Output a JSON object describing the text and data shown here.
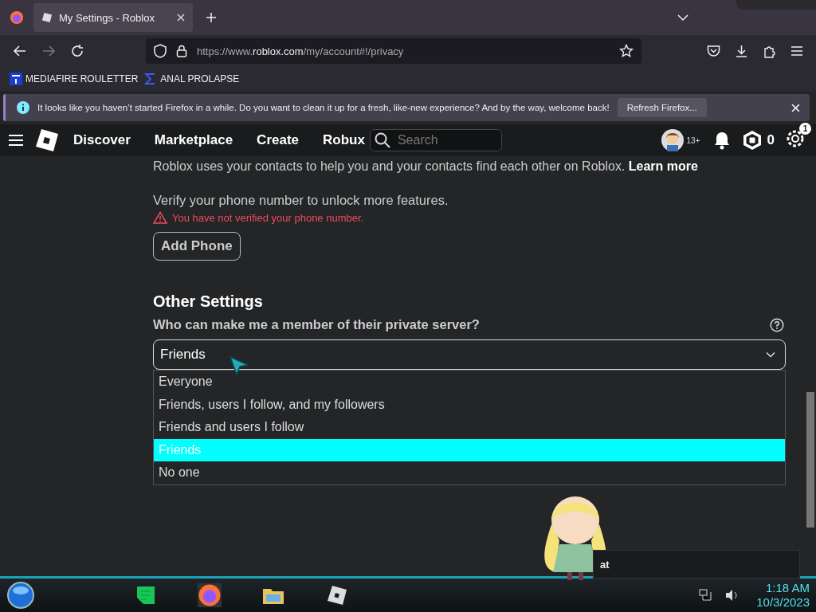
{
  "browser": {
    "tab_title": "My Settings - Roblox",
    "url_prefix": "https://www.",
    "url_domain": "roblox.com",
    "url_path": "/my/account#!/privacy",
    "bookmarks": [
      {
        "label": "MEDIAFIRE ROULETTER",
        "kind": "mf"
      },
      {
        "label": "ANAL PROLAPSE",
        "kind": "sigma"
      }
    ],
    "notice": {
      "text": "It looks like you haven’t started Firefox in a while. Do you want to clean it up for a fresh, like-new experience? And by the way, welcome back!",
      "button": "Refresh Firefox..."
    }
  },
  "nav": {
    "items": [
      "Discover",
      "Marketplace",
      "Create",
      "Robux"
    ],
    "search": {
      "placeholder": "Search"
    },
    "age_badge": "13+",
    "robux": "0",
    "settings_badge": "1"
  },
  "content": {
    "contacts_text": "Roblox uses your contacts to help you and your contacts find each other on Roblox.",
    "learn_more": "Learn more",
    "verify_text": "Verify your phone number to unlock more features.",
    "warning": "You have not verified your phone number.",
    "add_phone": "Add Phone",
    "section_title": "Other Settings",
    "question": "Who can make me a member of their private server?",
    "select_value": "Friends",
    "options": [
      {
        "label": "Everyone",
        "selected": false
      },
      {
        "label": "Friends, users I follow, and my followers",
        "selected": false
      },
      {
        "label": "Friends and users I follow",
        "selected": false
      },
      {
        "label": "Friends",
        "selected": true
      },
      {
        "label": "No one",
        "selected": false
      }
    ]
  },
  "chat": {
    "text": "at"
  },
  "taskbar": {
    "time": "1:18 AM",
    "date": "10/3/2023"
  }
}
